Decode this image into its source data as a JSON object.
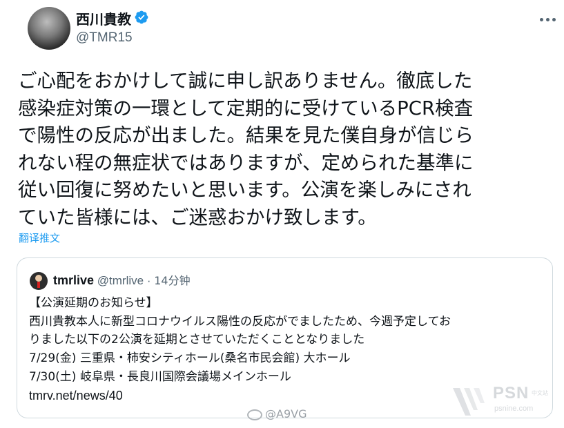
{
  "author": {
    "name": "西川貴教",
    "handle": "@TMR15",
    "verified": true
  },
  "tweet": {
    "lines": [
      "ご心配をおかけして誠に申し訳ありません。徹底した",
      "感染症対策の一環として定期的に受けているPCR検査",
      "で陽性の反応が出ました。結果を見た僕自身が信じら",
      "れない程の無症状ではありますが、定められた基準に",
      "従い回復に努めたいと思います。公演を楽しみにされ",
      "ていた皆様には、ご迷惑おかけ致します。"
    ],
    "translate_label": "翻译推文"
  },
  "quote": {
    "name": "tmrlive",
    "handle": "@tmrlive",
    "separator": "·",
    "time": "14分钟",
    "lines": [
      "【公演延期のお知らせ】",
      "西川貴教本人に新型コロナウイルス陽性の反応がでましたため、今週予定してお",
      "りました以下の2公演を延期とさせていただくこととなりました",
      "7/29(金) 三重県・柿安シティホール(桑名市民会館) 大ホール",
      "7/30(土) 岐阜県・長良川国際会議場メインホール",
      "tmrv.net/news/40"
    ]
  },
  "watermarks": {
    "weibo": "@A9VG",
    "psn": "PSN",
    "psn_site": "psnine.com",
    "psn_cn": "中文站"
  },
  "colors": {
    "text": "#0f1419",
    "secondary": "#536471",
    "accent": "#1d9bf0",
    "border": "#cfd9de"
  }
}
